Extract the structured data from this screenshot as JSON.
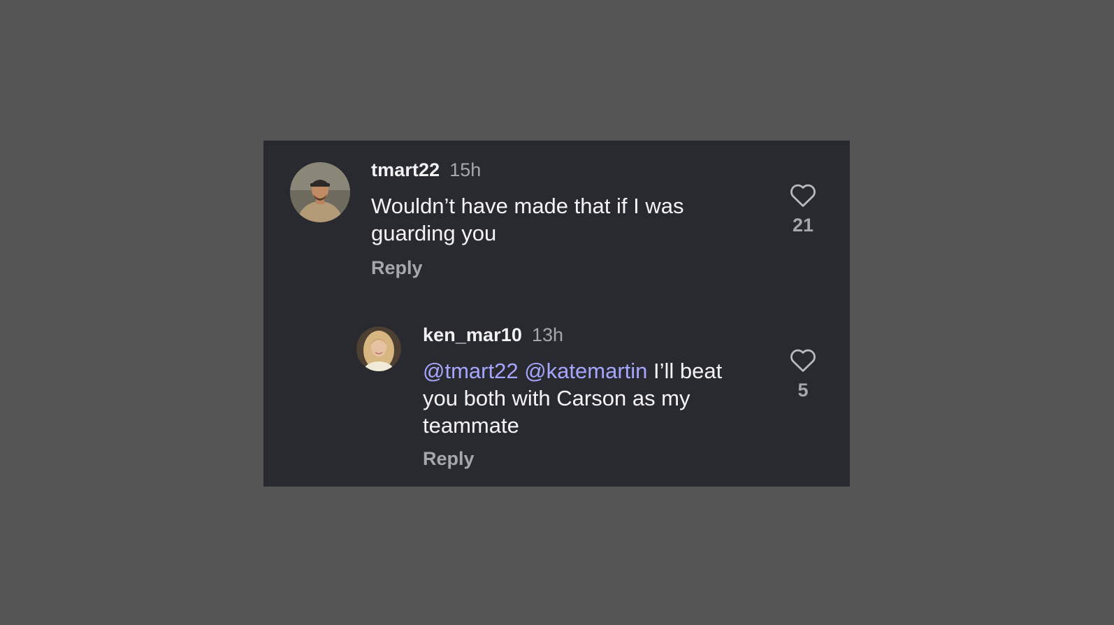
{
  "comments": [
    {
      "username": "tmart22",
      "time": "15h",
      "text": "Wouldn’t have made that if I was guarding you",
      "reply_label": "Reply",
      "likes": "21",
      "avatar_icon": "user-avatar-man-cap"
    },
    {
      "username": "ken_mar10",
      "time": "13h",
      "mentions": [
        "@tmart22",
        "@katemartin"
      ],
      "text": "I’ll beat you both with Carson as my teammate",
      "reply_label": "Reply",
      "likes": "5",
      "avatar_icon": "user-avatar-woman-blonde"
    }
  ],
  "colors": {
    "page_background": "#555555",
    "panel_background": "#292a30",
    "mention": "#a7a6ff",
    "secondary_text": "#a6a7ad"
  }
}
